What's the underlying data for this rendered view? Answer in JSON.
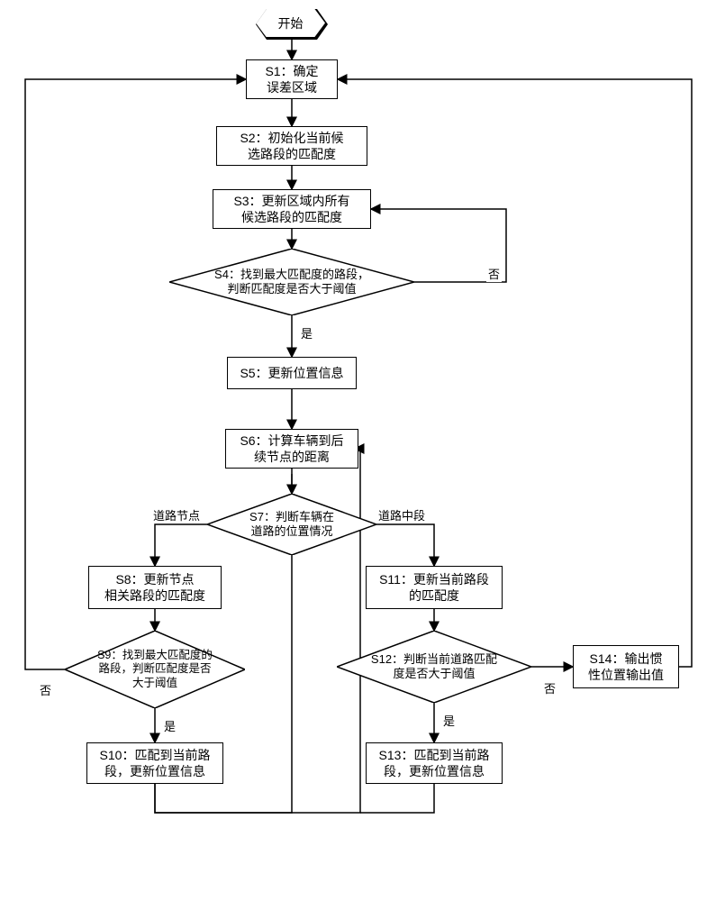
{
  "start": "开始",
  "s1": "S1：确定\n误差区域",
  "s2": "S2：初始化当前候\n选路段的匹配度",
  "s3": "S3：更新区域内所有\n候选路段的匹配度",
  "s4": "S4：找到最大匹配度的路段，\n判断匹配度是否大于阈值",
  "s5": "S5：更新位置信息",
  "s6": "S6：计算车辆到后\n续节点的距离",
  "s7": "S7：判断车辆在\n道路的位置情况",
  "s8": "S8：更新节点\n相关路段的匹配度",
  "s9": "S9：找到最大匹配度的\n路段，判断匹配度是否\n大于阈值",
  "s10": "S10：匹配到当前路\n段，更新位置信息",
  "s11": "S11：更新当前路段\n的匹配度",
  "s12": "S12：判断当前道路匹配\n度是否大于阈值",
  "s13": "S13：匹配到当前路\n段，更新位置信息",
  "s14": "S14：输出惯\n性位置输出值",
  "yes": "是",
  "no": "否",
  "node_label": "道路节点",
  "mid_label": "道路中段"
}
